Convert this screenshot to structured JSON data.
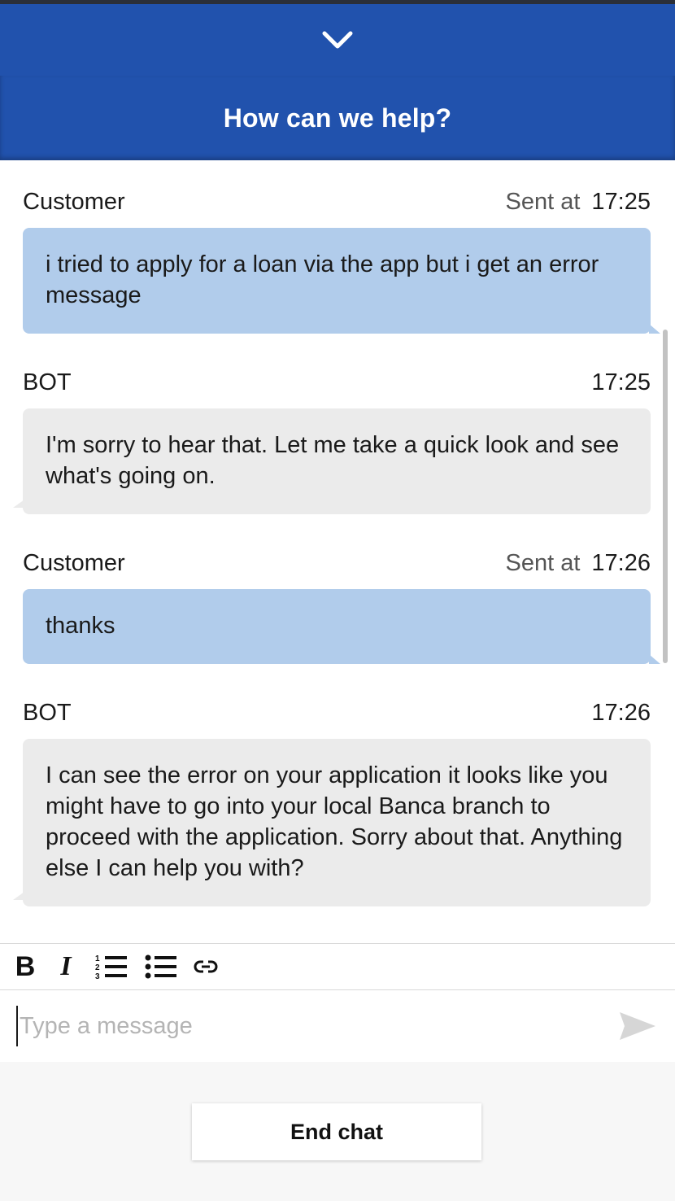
{
  "header": {
    "collapse_icon": "chevron-down-icon",
    "title": "How can we help?"
  },
  "messages": [
    {
      "sender": "Customer",
      "sent_label": "Sent at",
      "time": "17:25",
      "text": "i tried to apply for a loan via the app but i get an error message"
    },
    {
      "sender": "BOT",
      "time": "17:25",
      "text": "I'm sorry to hear that. Let me take a quick look and see what's going on."
    },
    {
      "sender": "Customer",
      "sent_label": "Sent at",
      "time": "17:26",
      "text": "thanks"
    },
    {
      "sender": "BOT",
      "time": "17:26",
      "text": "I can see the error on your application it looks like you might have to go into your local Banca branch to proceed with the application. Sorry about that. Anything else I can help you with?"
    }
  ],
  "toolbar": {
    "bold_label": "B",
    "italic_label": "I",
    "tools": [
      "bold-icon",
      "italic-icon",
      "ordered-list-icon",
      "bullet-list-icon",
      "link-icon"
    ]
  },
  "composer": {
    "placeholder": "Type a message",
    "value": "",
    "send_icon": "send-icon"
  },
  "footer": {
    "end_chat_label": "End chat"
  },
  "colors": {
    "brand": "#2152ad",
    "customer_bubble": "#b1cceb",
    "bot_bubble": "#ebebeb"
  }
}
